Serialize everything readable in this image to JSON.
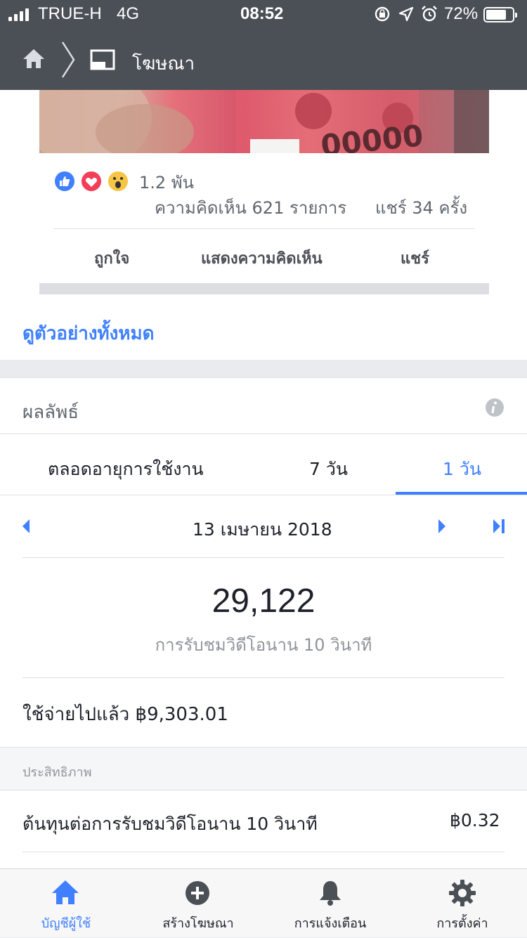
{
  "status": {
    "carrier": "TRUE-H",
    "network": "4G",
    "time": "08:52",
    "battery_pct": "72%"
  },
  "nav": {
    "title": "โฆษณา"
  },
  "post": {
    "reaction_count": "1.2 พัน",
    "comments": "ความคิดเห็น 621 รายการ",
    "shares": "แชร์ 34 ครั้ง",
    "actions": [
      "ถูกใจ",
      "แสดงความคิดเห็น",
      "แชร์"
    ]
  },
  "preview_link": "ดูตัวอย่างทั้งหมด",
  "results": {
    "title": "ผลลัพธ์",
    "tabs": [
      "ตลอดอายุการใช้งาน",
      "7 วัน",
      "1 วัน"
    ],
    "active_tab_index": 2,
    "date": "13 เมษายน 2018",
    "metric_value": "29,122",
    "metric_label": "การรับชมวิดีโอนาน 10 วินาที",
    "spent": "ใช้จ่ายไปแล้ว ฿9,303.01"
  },
  "performance": {
    "section_label": "ประสิทธิภาพ",
    "cost_label": "ต้นทุนต่อการรับชมวิดีโอนาน 10 วินาที",
    "cost_value": "฿0.32"
  },
  "tabbar": {
    "items": [
      "บัญชีผู้ใช้",
      "สร้างโฆษณา",
      "การแจ้งเตือน",
      "การตั้งค่า"
    ],
    "active_index": 0
  },
  "colors": {
    "accent": "#4080ff",
    "header_bg": "#4b4f56",
    "text_dark": "#1d2129",
    "text_muted": "#90949c"
  },
  "icons": [
    "home-icon",
    "chevron-right-icon",
    "ad-layout-icon",
    "info-icon",
    "arrow-left-icon",
    "arrow-right-icon",
    "skip-end-icon",
    "create-plus-icon",
    "bell-icon",
    "gear-icon"
  ]
}
